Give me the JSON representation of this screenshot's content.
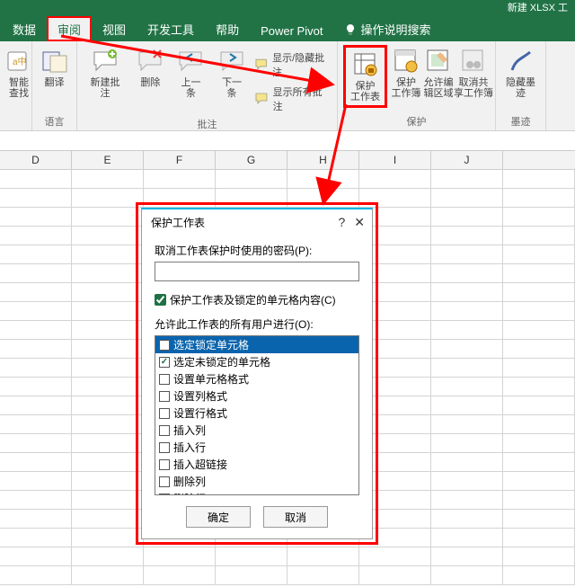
{
  "app": {
    "title_fragment": "新建 XLSX 工"
  },
  "tabs": {
    "data": "数据",
    "review": "审阅",
    "view": "视图",
    "dev": "开发工具",
    "help": "帮助",
    "pivot": "Power Pivot",
    "tellme": "操作说明搜索"
  },
  "ribbon": {
    "group_lang": "语言",
    "group_comment": "批注",
    "group_protect": "保护",
    "group_ink": "墨迹",
    "smart_lookup": "智能\n查找",
    "translate": "翻译",
    "new_comment": "新建批注",
    "delete": "删除",
    "prev": "上一条",
    "next": "下一条",
    "show_hide": "显示/隐藏批注",
    "show_all": "显示所有批注",
    "protect_sheet": "保护\n工作表",
    "protect_wb": "保护\n工作簿",
    "allow_edit": "允许编\n辑区域",
    "unshare": "取消共\n享工作簿",
    "hide_ink": "隐藏墨\n迹"
  },
  "columns": [
    "D",
    "E",
    "F",
    "G",
    "H",
    "I",
    "J"
  ],
  "dialog": {
    "title": "保护工作表",
    "help": "?",
    "close": "✕",
    "pwd_label": "取消工作表保护时使用的密码(P):",
    "chk_main": "保护工作表及锁定的单元格内容(C)",
    "list_label": "允许此工作表的所有用户进行(O):",
    "options": [
      {
        "label": "选定锁定单元格",
        "checked": true,
        "selected": true
      },
      {
        "label": "选定未锁定的单元格",
        "checked": true,
        "selected": false
      },
      {
        "label": "设置单元格格式",
        "checked": false,
        "selected": false
      },
      {
        "label": "设置列格式",
        "checked": false,
        "selected": false
      },
      {
        "label": "设置行格式",
        "checked": false,
        "selected": false
      },
      {
        "label": "插入列",
        "checked": false,
        "selected": false
      },
      {
        "label": "插入行",
        "checked": false,
        "selected": false
      },
      {
        "label": "插入超链接",
        "checked": false,
        "selected": false
      },
      {
        "label": "删除列",
        "checked": false,
        "selected": false
      },
      {
        "label": "删除行",
        "checked": false,
        "selected": false
      }
    ],
    "ok": "确定",
    "cancel": "取消"
  }
}
